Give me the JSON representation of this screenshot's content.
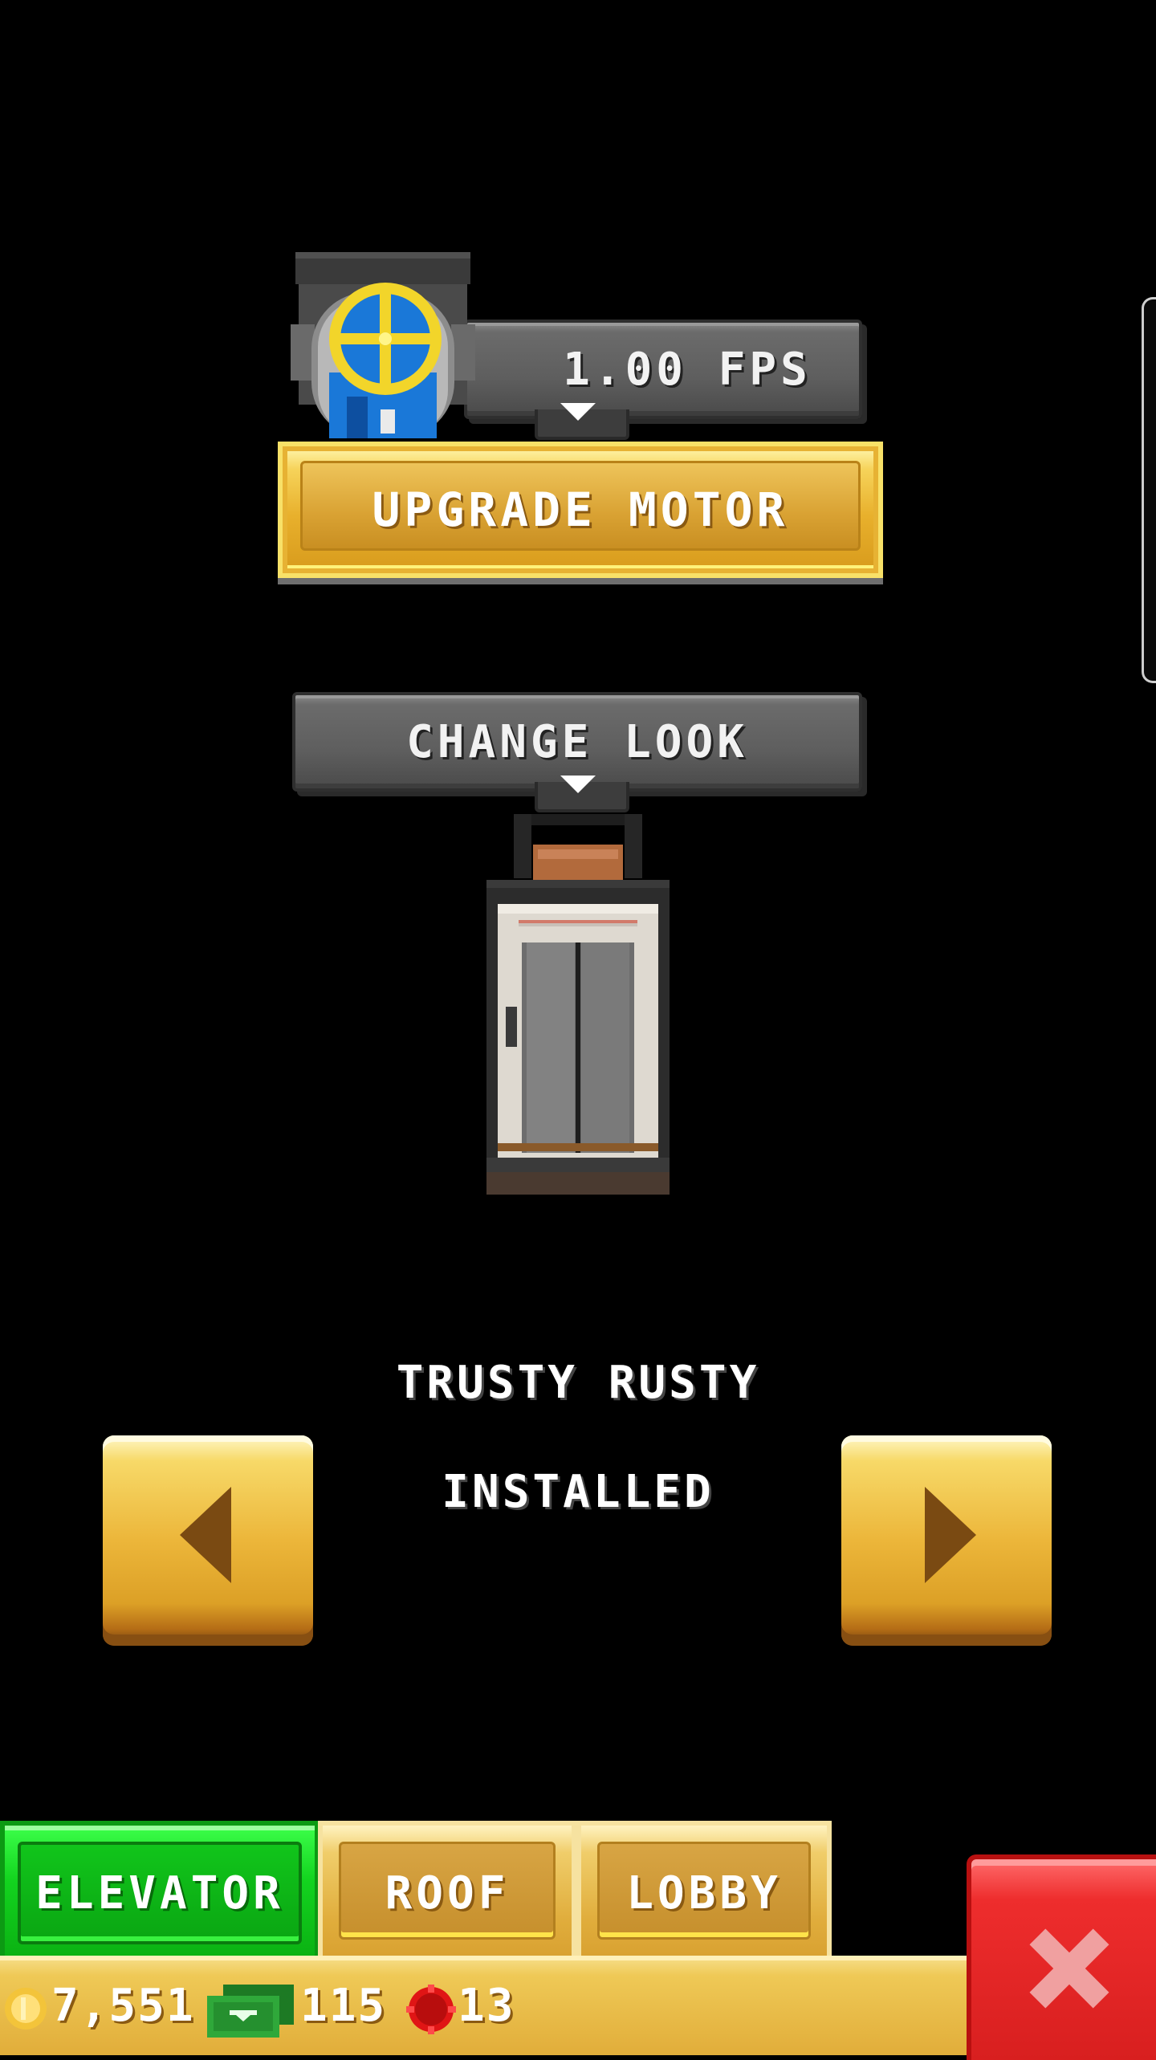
{
  "motor": {
    "speed_label": "1.00 FPS",
    "upgrade_label": "UPGRADE MOTOR"
  },
  "look": {
    "change_label": "CHANGE LOOK",
    "name": "TRUSTY RUSTY",
    "status": "INSTALLED"
  },
  "tabs": [
    {
      "label": "ELEVATOR",
      "active": true
    },
    {
      "label": "ROOF",
      "active": false
    },
    {
      "label": "LOBBY",
      "active": false
    }
  ],
  "currency": {
    "coins": "7,551",
    "bux": "115",
    "tokens": "13"
  },
  "colors": {
    "gold": "#e8b02c",
    "active_tab": "#13d41f",
    "close": "#e52626"
  },
  "icons": {
    "motor": "motor-fan-icon",
    "elevator": "elevator-car-icon",
    "prev": "arrow-left-icon",
    "next": "arrow-right-icon",
    "close": "close-x-icon",
    "coin": "coin-icon",
    "bux": "bux-cash-icon",
    "token": "red-token-icon"
  }
}
